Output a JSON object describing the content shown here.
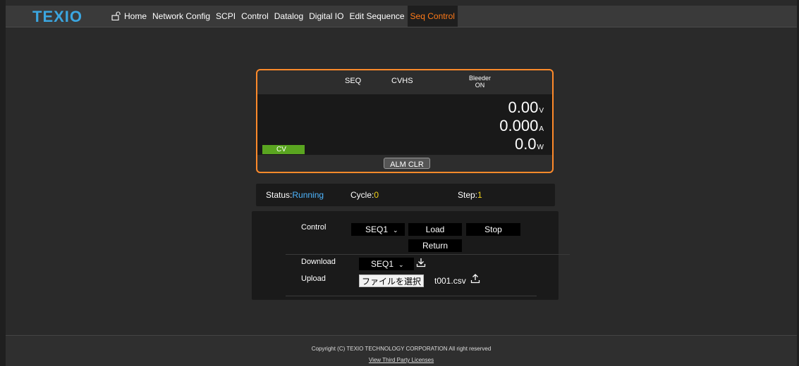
{
  "brand": {
    "logo_text": "TEXIO"
  },
  "nav": {
    "items": [
      {
        "label": "Home"
      },
      {
        "label": "Network Config"
      },
      {
        "label": "SCPI"
      },
      {
        "label": "Control"
      },
      {
        "label": "Datalog"
      },
      {
        "label": "Digital IO"
      },
      {
        "label": "Edit Sequence"
      },
      {
        "label": "Seq Control",
        "active": true
      }
    ]
  },
  "display": {
    "mode_seq": "SEQ",
    "mode_cvhs": "CVHS",
    "bleeder_label": "Bleeder",
    "bleeder_state": "ON",
    "voltage": "0.00",
    "voltage_unit": "V",
    "current": "0.000",
    "current_unit": "A",
    "power": "0.0",
    "power_unit": "W",
    "cv_tag": "CV",
    "alm_clr_label": "ALM CLR"
  },
  "status": {
    "status_label": "Status:",
    "status_value": "Running",
    "cycle_label": "Cycle:",
    "cycle_value": "0",
    "step_label": "Step:",
    "step_value": "1"
  },
  "control": {
    "control_label": "Control",
    "control_select": "SEQ1",
    "load_label": "Load",
    "stop_label": "Stop",
    "return_label": "Return",
    "download_label": "Download",
    "download_select": "SEQ1",
    "upload_label": "Upload",
    "file_button_label": "ファイルを選択",
    "file_name": "t001.csv"
  },
  "footer": {
    "copyright": "Copyright (C) TEXIO TECHNOLOGY CORPORATION All right reserved",
    "licenses_link": "View Third Party Licenses"
  },
  "colors": {
    "accent": "#ff8a2a",
    "logo": "#3ba6e0",
    "cv_tag": "#5aa520",
    "status_running": "#4fb6ff",
    "counter_value": "#f2d21a"
  },
  "icons": [
    "lock-open-icon",
    "chevron-down-icon",
    "download-icon",
    "upload-icon"
  ]
}
